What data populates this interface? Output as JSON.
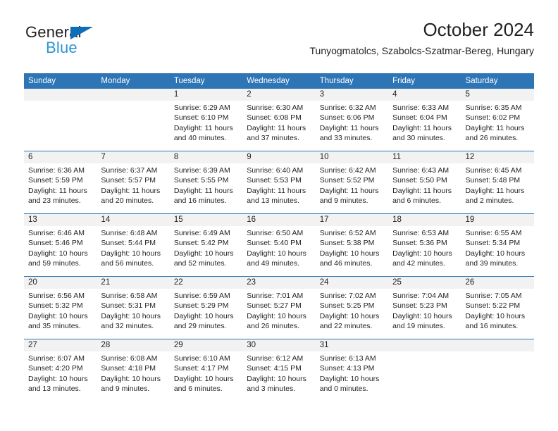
{
  "brand": {
    "name_top": "General",
    "name_bottom": "Blue",
    "accent_color": "#0f6cb6",
    "accent_light": "#2e95d3"
  },
  "header": {
    "title": "October 2024",
    "subtitle": "Tunyogmatolcs, Szabolcs-Szatmar-Bereg, Hungary"
  },
  "theme": {
    "header_bar_color": "#2e75b6",
    "day_band_color": "#f2f2f2",
    "text_color": "#231f20"
  },
  "calendar": {
    "weekdays": [
      "Sunday",
      "Monday",
      "Tuesday",
      "Wednesday",
      "Thursday",
      "Friday",
      "Saturday"
    ],
    "weeks": [
      [
        {
          "day": "",
          "sunrise": "",
          "sunset": "",
          "daylight": ""
        },
        {
          "day": "",
          "sunrise": "",
          "sunset": "",
          "daylight": ""
        },
        {
          "day": "1",
          "sunrise": "Sunrise: 6:29 AM",
          "sunset": "Sunset: 6:10 PM",
          "daylight": "Daylight: 11 hours and 40 minutes."
        },
        {
          "day": "2",
          "sunrise": "Sunrise: 6:30 AM",
          "sunset": "Sunset: 6:08 PM",
          "daylight": "Daylight: 11 hours and 37 minutes."
        },
        {
          "day": "3",
          "sunrise": "Sunrise: 6:32 AM",
          "sunset": "Sunset: 6:06 PM",
          "daylight": "Daylight: 11 hours and 33 minutes."
        },
        {
          "day": "4",
          "sunrise": "Sunrise: 6:33 AM",
          "sunset": "Sunset: 6:04 PM",
          "daylight": "Daylight: 11 hours and 30 minutes."
        },
        {
          "day": "5",
          "sunrise": "Sunrise: 6:35 AM",
          "sunset": "Sunset: 6:02 PM",
          "daylight": "Daylight: 11 hours and 26 minutes."
        }
      ],
      [
        {
          "day": "6",
          "sunrise": "Sunrise: 6:36 AM",
          "sunset": "Sunset: 5:59 PM",
          "daylight": "Daylight: 11 hours and 23 minutes."
        },
        {
          "day": "7",
          "sunrise": "Sunrise: 6:37 AM",
          "sunset": "Sunset: 5:57 PM",
          "daylight": "Daylight: 11 hours and 20 minutes."
        },
        {
          "day": "8",
          "sunrise": "Sunrise: 6:39 AM",
          "sunset": "Sunset: 5:55 PM",
          "daylight": "Daylight: 11 hours and 16 minutes."
        },
        {
          "day": "9",
          "sunrise": "Sunrise: 6:40 AM",
          "sunset": "Sunset: 5:53 PM",
          "daylight": "Daylight: 11 hours and 13 minutes."
        },
        {
          "day": "10",
          "sunrise": "Sunrise: 6:42 AM",
          "sunset": "Sunset: 5:52 PM",
          "daylight": "Daylight: 11 hours and 9 minutes."
        },
        {
          "day": "11",
          "sunrise": "Sunrise: 6:43 AM",
          "sunset": "Sunset: 5:50 PM",
          "daylight": "Daylight: 11 hours and 6 minutes."
        },
        {
          "day": "12",
          "sunrise": "Sunrise: 6:45 AM",
          "sunset": "Sunset: 5:48 PM",
          "daylight": "Daylight: 11 hours and 2 minutes."
        }
      ],
      [
        {
          "day": "13",
          "sunrise": "Sunrise: 6:46 AM",
          "sunset": "Sunset: 5:46 PM",
          "daylight": "Daylight: 10 hours and 59 minutes."
        },
        {
          "day": "14",
          "sunrise": "Sunrise: 6:48 AM",
          "sunset": "Sunset: 5:44 PM",
          "daylight": "Daylight: 10 hours and 56 minutes."
        },
        {
          "day": "15",
          "sunrise": "Sunrise: 6:49 AM",
          "sunset": "Sunset: 5:42 PM",
          "daylight": "Daylight: 10 hours and 52 minutes."
        },
        {
          "day": "16",
          "sunrise": "Sunrise: 6:50 AM",
          "sunset": "Sunset: 5:40 PM",
          "daylight": "Daylight: 10 hours and 49 minutes."
        },
        {
          "day": "17",
          "sunrise": "Sunrise: 6:52 AM",
          "sunset": "Sunset: 5:38 PM",
          "daylight": "Daylight: 10 hours and 46 minutes."
        },
        {
          "day": "18",
          "sunrise": "Sunrise: 6:53 AM",
          "sunset": "Sunset: 5:36 PM",
          "daylight": "Daylight: 10 hours and 42 minutes."
        },
        {
          "day": "19",
          "sunrise": "Sunrise: 6:55 AM",
          "sunset": "Sunset: 5:34 PM",
          "daylight": "Daylight: 10 hours and 39 minutes."
        }
      ],
      [
        {
          "day": "20",
          "sunrise": "Sunrise: 6:56 AM",
          "sunset": "Sunset: 5:32 PM",
          "daylight": "Daylight: 10 hours and 35 minutes."
        },
        {
          "day": "21",
          "sunrise": "Sunrise: 6:58 AM",
          "sunset": "Sunset: 5:31 PM",
          "daylight": "Daylight: 10 hours and 32 minutes."
        },
        {
          "day": "22",
          "sunrise": "Sunrise: 6:59 AM",
          "sunset": "Sunset: 5:29 PM",
          "daylight": "Daylight: 10 hours and 29 minutes."
        },
        {
          "day": "23",
          "sunrise": "Sunrise: 7:01 AM",
          "sunset": "Sunset: 5:27 PM",
          "daylight": "Daylight: 10 hours and 26 minutes."
        },
        {
          "day": "24",
          "sunrise": "Sunrise: 7:02 AM",
          "sunset": "Sunset: 5:25 PM",
          "daylight": "Daylight: 10 hours and 22 minutes."
        },
        {
          "day": "25",
          "sunrise": "Sunrise: 7:04 AM",
          "sunset": "Sunset: 5:23 PM",
          "daylight": "Daylight: 10 hours and 19 minutes."
        },
        {
          "day": "26",
          "sunrise": "Sunrise: 7:05 AM",
          "sunset": "Sunset: 5:22 PM",
          "daylight": "Daylight: 10 hours and 16 minutes."
        }
      ],
      [
        {
          "day": "27",
          "sunrise": "Sunrise: 6:07 AM",
          "sunset": "Sunset: 4:20 PM",
          "daylight": "Daylight: 10 hours and 13 minutes."
        },
        {
          "day": "28",
          "sunrise": "Sunrise: 6:08 AM",
          "sunset": "Sunset: 4:18 PM",
          "daylight": "Daylight: 10 hours and 9 minutes."
        },
        {
          "day": "29",
          "sunrise": "Sunrise: 6:10 AM",
          "sunset": "Sunset: 4:17 PM",
          "daylight": "Daylight: 10 hours and 6 minutes."
        },
        {
          "day": "30",
          "sunrise": "Sunrise: 6:12 AM",
          "sunset": "Sunset: 4:15 PM",
          "daylight": "Daylight: 10 hours and 3 minutes."
        },
        {
          "day": "31",
          "sunrise": "Sunrise: 6:13 AM",
          "sunset": "Sunset: 4:13 PM",
          "daylight": "Daylight: 10 hours and 0 minutes."
        },
        {
          "day": "",
          "sunrise": "",
          "sunset": "",
          "daylight": ""
        },
        {
          "day": "",
          "sunrise": "",
          "sunset": "",
          "daylight": ""
        }
      ]
    ]
  }
}
